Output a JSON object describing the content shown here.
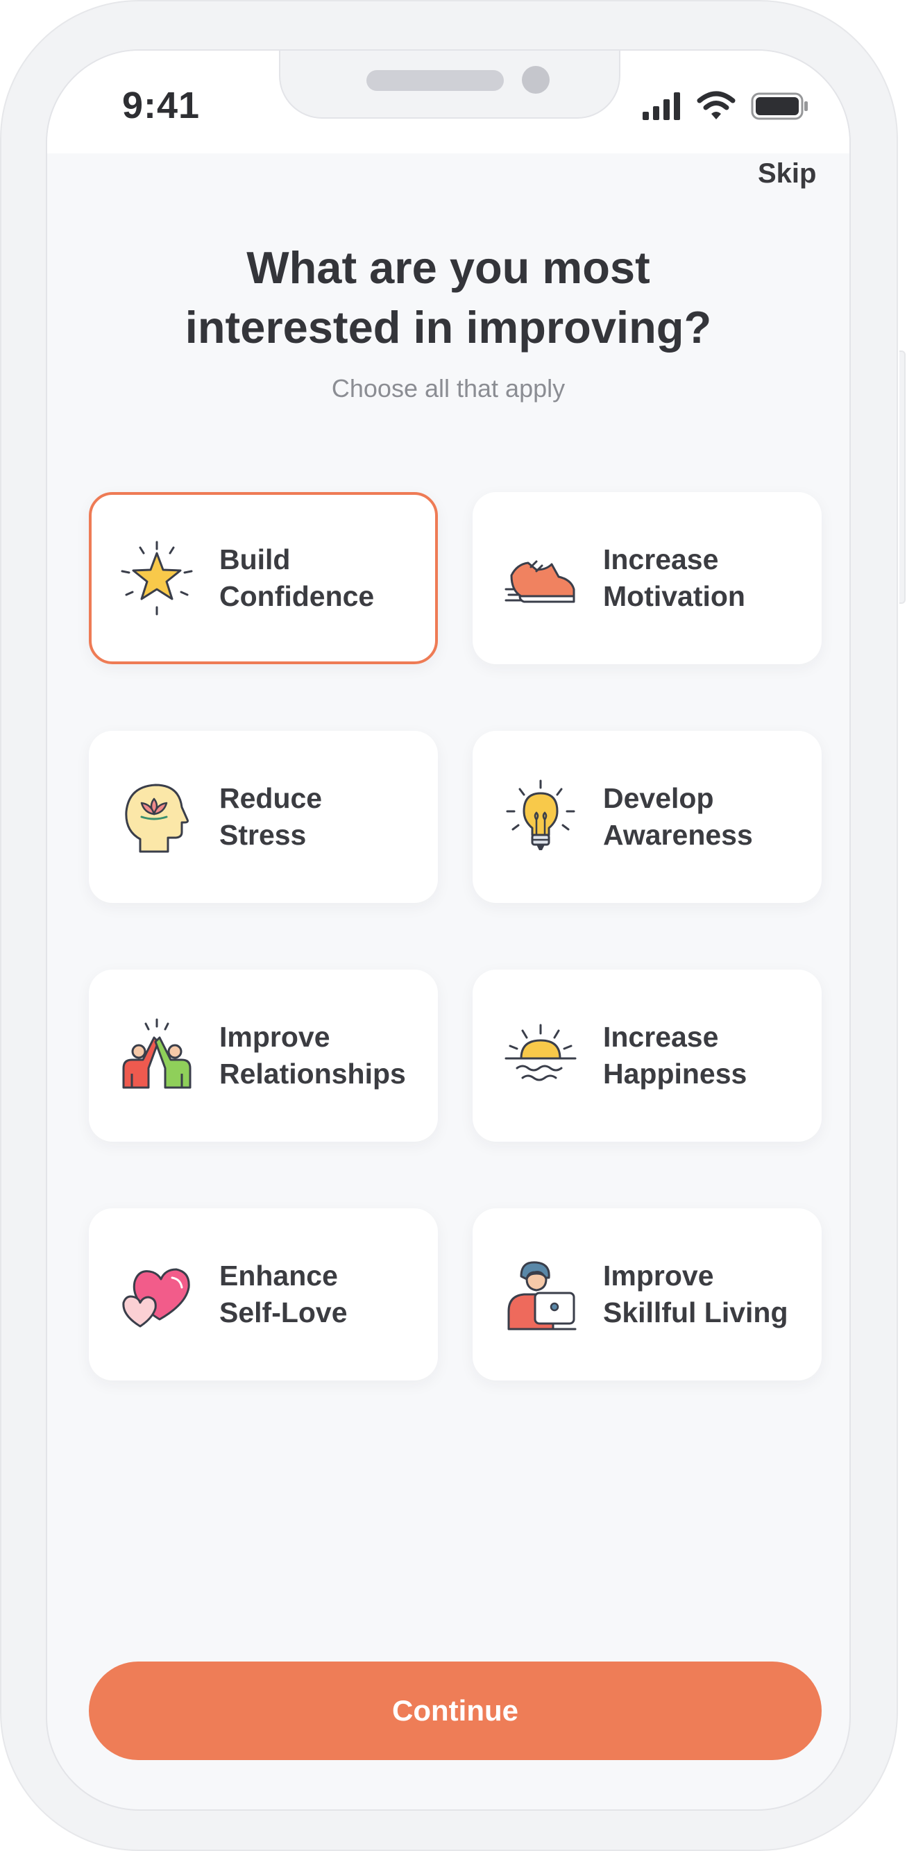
{
  "status_bar": {
    "time": "9:41",
    "icons": [
      "signal-icon",
      "wifi-icon",
      "battery-icon"
    ]
  },
  "header": {
    "skip_label": "Skip",
    "title_line1": "What are you most",
    "title_line2": "interested in improving?",
    "subtitle": "Choose all that apply"
  },
  "options": [
    {
      "line1": "Build",
      "line2": "Confidence",
      "icon": "star-icon",
      "selected": true
    },
    {
      "line1": "Increase",
      "line2": "Motivation",
      "icon": "running-shoe-icon",
      "selected": false
    },
    {
      "line1": "Reduce",
      "line2": "Stress",
      "icon": "lotus-head-icon",
      "selected": false
    },
    {
      "line1": "Develop",
      "line2": "Awareness",
      "icon": "lightbulb-icon",
      "selected": false
    },
    {
      "line1": "Improve",
      "line2": "Relationships",
      "icon": "high-five-icon",
      "selected": false
    },
    {
      "line1": "Increase",
      "line2": "Happiness",
      "icon": "sunrise-icon",
      "selected": false
    },
    {
      "line1": "Enhance",
      "line2": "Self-Love",
      "icon": "hearts-icon",
      "selected": false
    },
    {
      "line1": "Improve",
      "line2": "Skillful Living",
      "icon": "person-laptop-icon",
      "selected": false
    }
  ],
  "footer": {
    "continue_label": "Continue"
  },
  "colors": {
    "accent": "#ee7d57",
    "selected_border": "#ee7b55",
    "background": "#f7f8fa",
    "card": "#ffffff",
    "text": "#3b3c41",
    "muted": "#8b8d93"
  }
}
